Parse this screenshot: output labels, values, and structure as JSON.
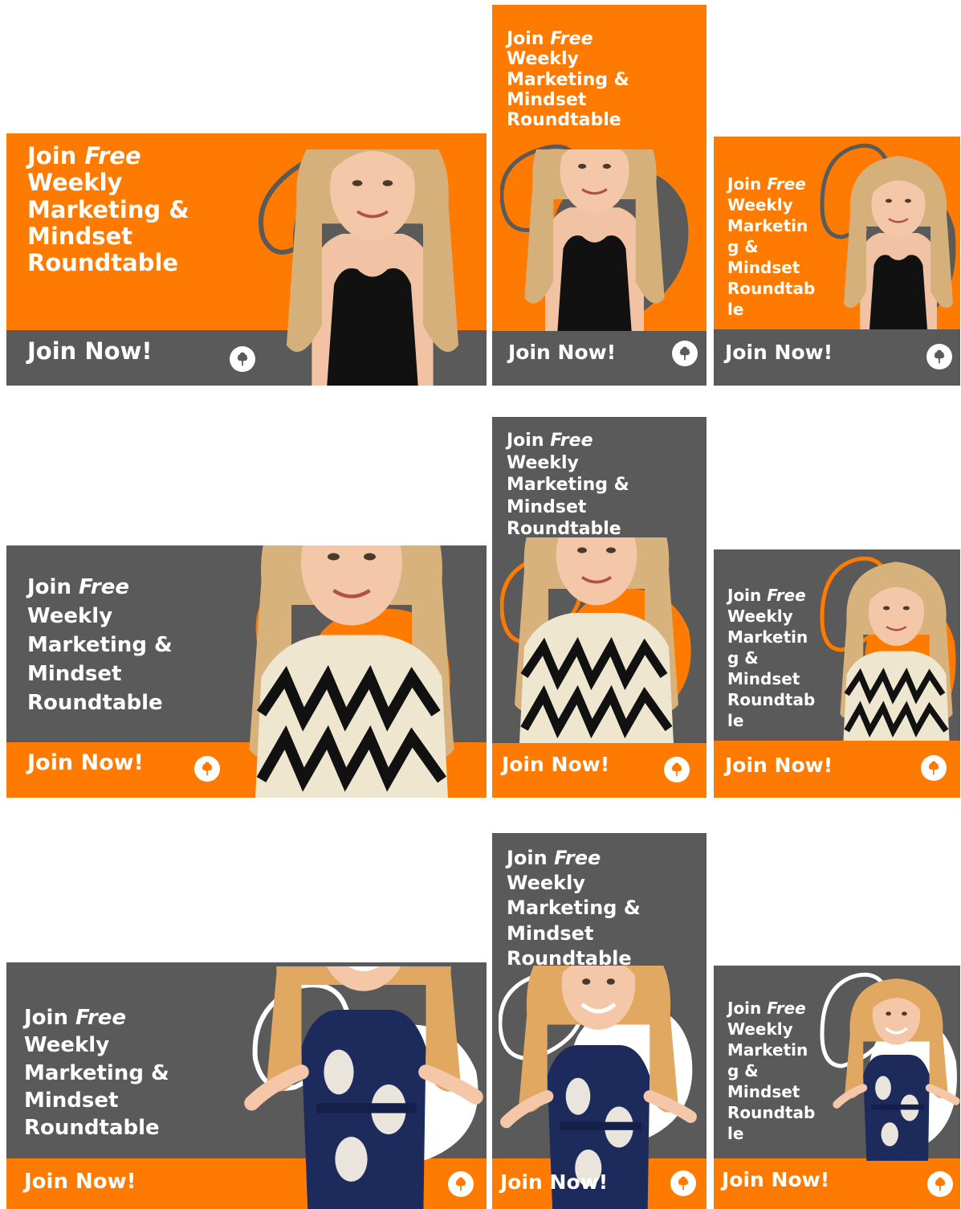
{
  "colors": {
    "orange": "#ff7a00",
    "gray": "#5a5a5a",
    "white": "#ffffff"
  },
  "headline": {
    "join": "Join",
    "free": "Free",
    "line2": "Weekly",
    "line3": "Marketing &",
    "line4": "Mindset",
    "line5": "Roundtable"
  },
  "headline_narrow": {
    "line3a": "Marketin",
    "line3b": "g &",
    "line5a": "Roundtab",
    "line5b": "le"
  },
  "cta": "Join Now!",
  "logo_icon": "tree-logo-icon",
  "photos": {
    "row1": "woman-black-top-photo",
    "row2": "woman-patterned-top-photo",
    "row3": "woman-navy-dress-photo"
  }
}
